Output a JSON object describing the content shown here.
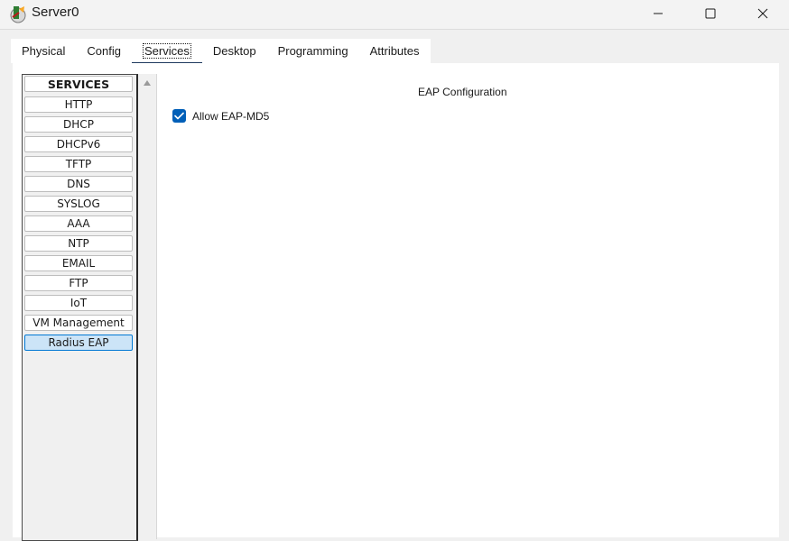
{
  "window": {
    "title": "Server0",
    "icon": "network-server-icon",
    "controls": [
      "minimize-icon",
      "maximize-icon",
      "close-icon"
    ]
  },
  "tabs": [
    {
      "label": "Physical"
    },
    {
      "label": "Config"
    },
    {
      "label": "Services",
      "active": true
    },
    {
      "label": "Desktop"
    },
    {
      "label": "Programming"
    },
    {
      "label": "Attributes"
    }
  ],
  "services": {
    "header": "SERVICES",
    "items": [
      "HTTP",
      "DHCP",
      "DHCPv6",
      "TFTP",
      "DNS",
      "SYSLOG",
      "AAA",
      "NTP",
      "EMAIL",
      "FTP",
      "IoT",
      "VM Management",
      "Radius EAP"
    ],
    "selected": "Radius EAP"
  },
  "eap": {
    "title": "EAP Configuration",
    "allow_md5_label": "Allow EAP-MD5",
    "allow_md5_checked": true
  },
  "colors": {
    "accent": "#005fb8",
    "tab_indicator": "#1f3a5f",
    "selected_item_bg": "#cce4f7",
    "selected_item_border": "#0078d4"
  }
}
